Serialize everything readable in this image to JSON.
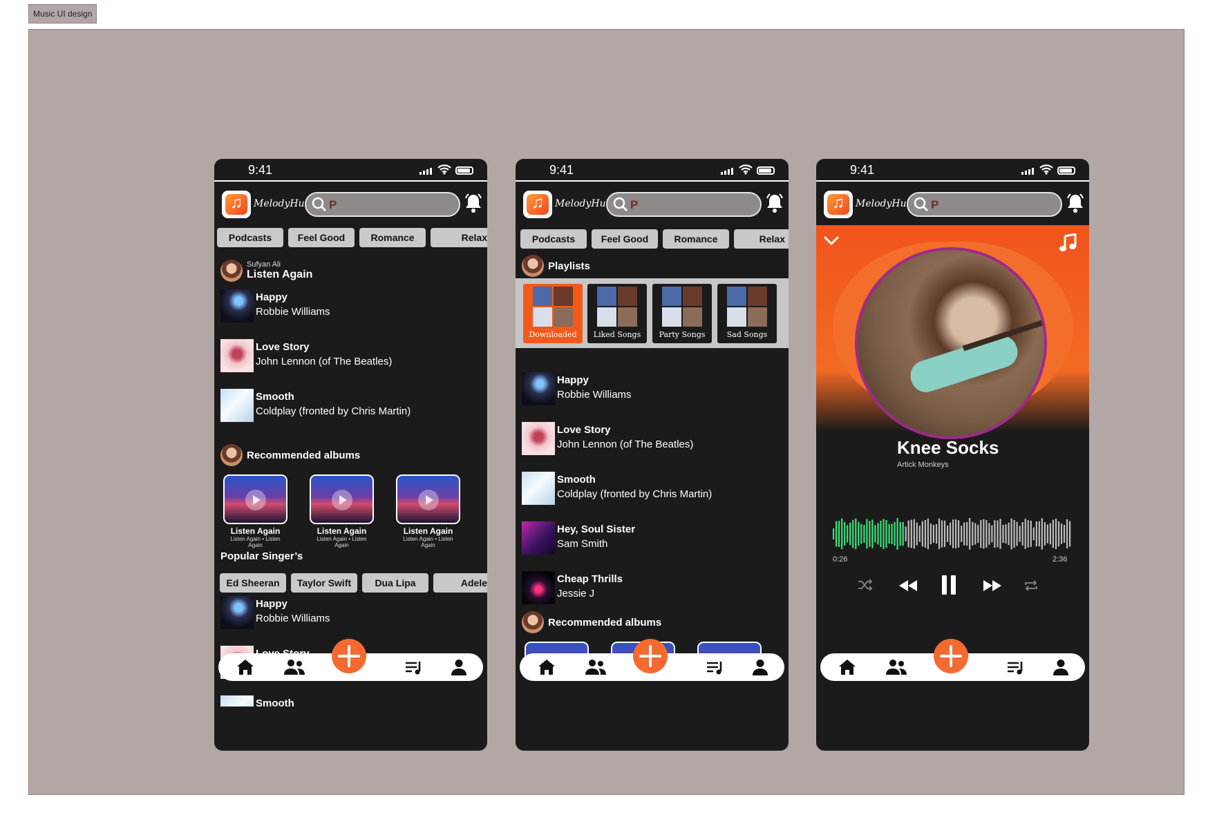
{
  "frame_label": "Music UI design",
  "status": {
    "time": "9:41"
  },
  "app": {
    "brand": "MelodyHub",
    "search_placeholder": "P"
  },
  "chips": [
    "Podcasts",
    "Feel Good",
    "Romance",
    "Relax"
  ],
  "singers": [
    "Ed Sheeran",
    "Taylor Swift",
    "Dua Lipa",
    "Adele"
  ],
  "home": {
    "user_name": "Sufyan Ali",
    "listen_again_title": "Listen Again",
    "recommended_title": "Recommended albums",
    "popular_title": "Popular Singer’s"
  },
  "playlists_title": "Playlists",
  "playlists": [
    "Downloaded",
    "Liked Songs",
    "Party Songs",
    "Sad Songs"
  ],
  "songs": [
    {
      "title": "Happy",
      "artist": "Robbie Williams"
    },
    {
      "title": "Love Story",
      "artist": "John Lennon (of The Beatles)"
    },
    {
      "title": "Smooth",
      "artist": "Coldplay (fronted by Chris Martin)"
    },
    {
      "title": "Hey, Soul Sister",
      "artist": "Sam Smith"
    },
    {
      "title": "Cheap Thrills",
      "artist": "Jessie J"
    }
  ],
  "album": {
    "title": "Listen Again",
    "sub": "Listen Again • Listen Again"
  },
  "player": {
    "title": "Knee Socks",
    "artist": "Artick Monkeys",
    "current_time": "0:26",
    "total_time": "2:36",
    "progress": 0.3
  },
  "colors": {
    "accent": "#f46a31",
    "wave_played": "#3fe07a",
    "background": "#1c1b1b"
  },
  "icons": [
    "home-icon",
    "friends-icon",
    "add-icon",
    "playlist-icon",
    "profile-icon",
    "bell-icon",
    "search-icon",
    "music-note-icon",
    "chevron-down-icon",
    "shuffle-icon",
    "rewind-icon",
    "pause-icon",
    "fast-forward-icon",
    "repeat-icon"
  ]
}
